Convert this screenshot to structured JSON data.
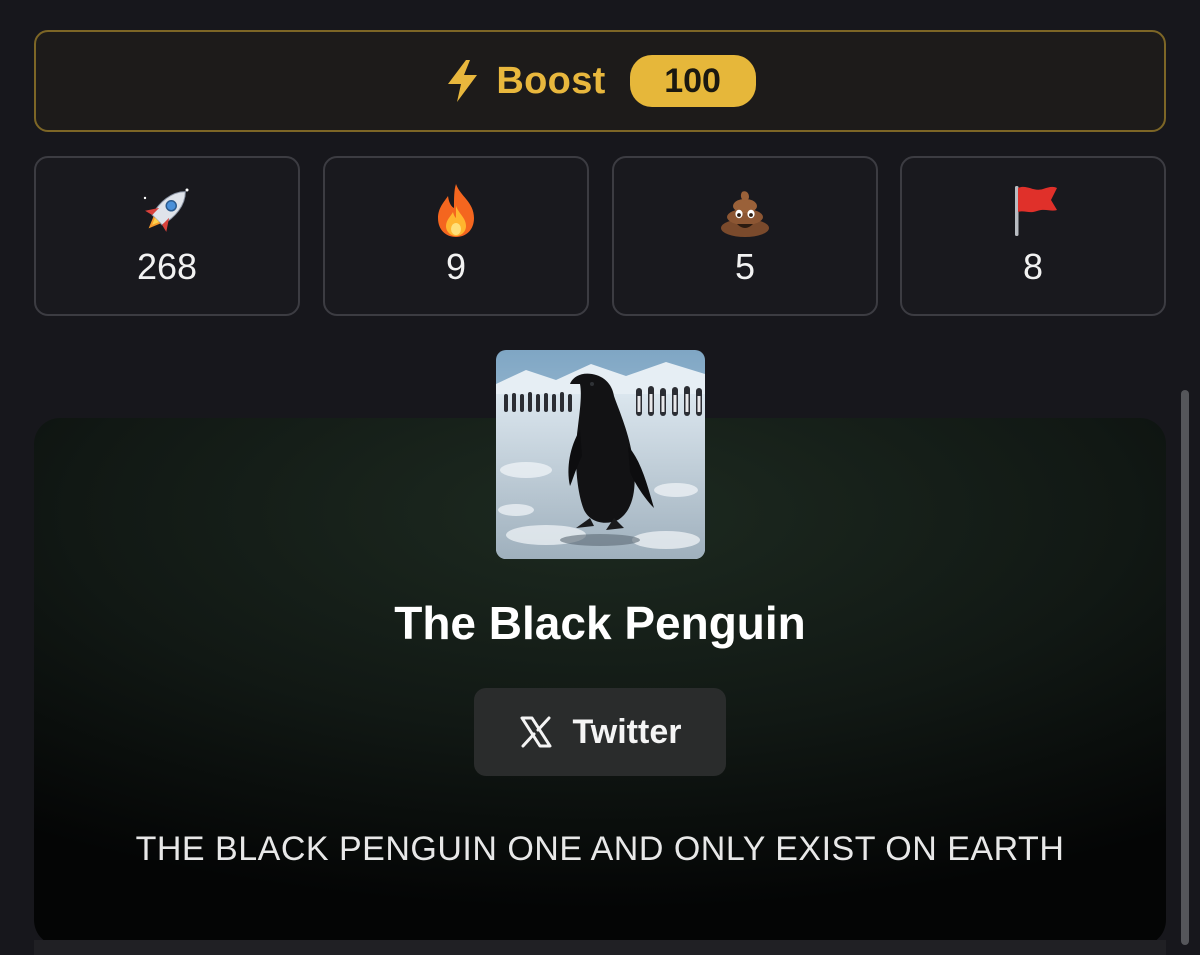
{
  "boost": {
    "label": "Boost",
    "count": "100",
    "icon": "lightning-bolt-icon",
    "accent": "#e6b73a"
  },
  "stats": [
    {
      "icon": "rocket-icon",
      "count": "268"
    },
    {
      "icon": "fire-icon",
      "count": "9"
    },
    {
      "icon": "poop-icon",
      "count": "5"
    },
    {
      "icon": "red-flag-icon",
      "count": "8"
    }
  ],
  "profile": {
    "name": "The Black Penguin",
    "avatar": "black-penguin-image",
    "twitter_label": "Twitter",
    "description": "THE BLACK PENGUIN ONE AND ONLY EXIST ON EARTH"
  }
}
